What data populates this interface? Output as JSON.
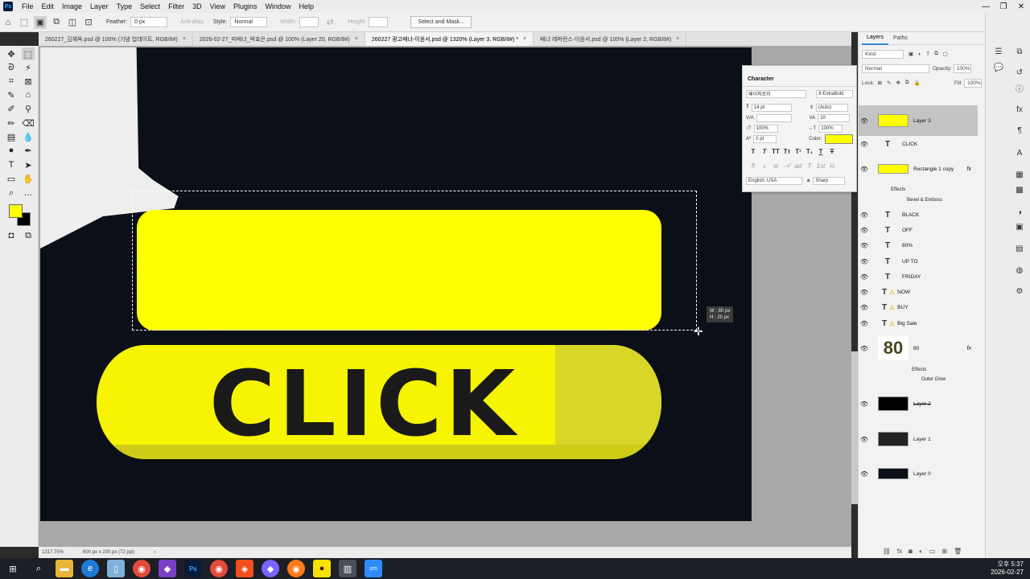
{
  "menubar": {
    "logo": "Ps",
    "items": [
      "File",
      "Edit",
      "Image",
      "Layer",
      "Type",
      "Select",
      "Filter",
      "3D",
      "View",
      "Plugins",
      "Window",
      "Help"
    ],
    "window_controls": [
      "—",
      "❐",
      "✕"
    ]
  },
  "options_bar": {
    "feather_label": "Feather:",
    "feather_value": "0 px",
    "antialias_label": "Anti-alias",
    "style_label": "Style:",
    "style_value": "Normal",
    "width_label": "Width:",
    "height_label": "Height:",
    "select_mask_label": "Select and Mask..."
  },
  "tabs": [
    {
      "label": "260227_김혜옥.psd @ 100% (기념 업데이트, RGB/8#)",
      "active": false
    },
    {
      "label": "2026-02-27_띠배너_박효은.psd @ 100% (Layer 20, RGB/8#)",
      "active": false
    },
    {
      "label": "260227 광고배너-이윤서.psd @ 1320% (Layer 3, RGB/8#) *",
      "active": true
    },
    {
      "label": "배너 레퍼런스-이윤서.psd @ 100% (Layer 2, RGB/8#)",
      "active": false
    }
  ],
  "tab_close": "×",
  "canvas": {
    "button_text": "CLICK",
    "readout_w": "W : 80 px",
    "readout_h": "H : 20 px"
  },
  "status": {
    "zoom": "1317.75%",
    "doc_size": "600 px x 200 px (72 ppi)"
  },
  "character_panel": {
    "title": "Character",
    "font_family": "페이퍼로지",
    "font_style": "8 ExtraBold",
    "size": "14 pt",
    "leading": "(Auto)",
    "kerning": "",
    "tracking": "10",
    "vscale": "100%",
    "hscale": "100%",
    "baseline": "0 pt",
    "color_label": "Color:",
    "language": "English: USA",
    "aa_label": "a",
    "aa_value": "Sharp"
  },
  "layers_panel": {
    "tabs": [
      "Layers",
      "Paths"
    ],
    "filter_kind": "Kind",
    "blend_mode": "Normal",
    "opacity_label": "Opacity:",
    "opacity_value": "100%",
    "lock_label": "Lock:",
    "fill_label": "Fill:",
    "fill_value": "100%",
    "layers": [
      {
        "name": "Layer 3",
        "kind": "pixel-yellow",
        "selected": true
      },
      {
        "name": "CLICK",
        "kind": "text"
      },
      {
        "name": "Rectangle 1 copy",
        "kind": "pixel-yellow",
        "fx": "fx"
      },
      {
        "name": "BLACK",
        "kind": "text"
      },
      {
        "name": "OFF",
        "kind": "text"
      },
      {
        "name": "80%",
        "kind": "text"
      },
      {
        "name": "UP TO",
        "kind": "text"
      },
      {
        "name": "FRIDAY",
        "kind": "text"
      },
      {
        "name": "NOW",
        "kind": "text-warn"
      },
      {
        "name": "BUY",
        "kind": "text-warn"
      },
      {
        "name": "Big Sale",
        "kind": "text-warn"
      },
      {
        "name": "80",
        "kind": "smart",
        "fx": "fx"
      },
      {
        "name": "Layer 2",
        "kind": "pixel-dark"
      },
      {
        "name": "Layer 1",
        "kind": "pixel-dark"
      },
      {
        "name": "Layer 0",
        "kind": "pixel-dark"
      }
    ],
    "effects_label": "Effects",
    "bevel_label": "Bevel & Emboss",
    "outer_glow_label": "Outer Glow",
    "thumb_80_text": "80"
  },
  "taskbar": {
    "apps": [
      "win-icon",
      "search-icon",
      "explorer-icon",
      "edge-icon",
      "files-icon",
      "chrome-icon",
      "vs-icon",
      "photoshop-icon",
      "chrome-icon",
      "figma-icon",
      "droplet-icon",
      "firefox-icon",
      "kakao-icon",
      "store-icon",
      "zoom-icon"
    ],
    "ps_label": "Ps",
    "zm_label": "zm",
    "time": "오후 5:37",
    "date": "2026-02-27"
  },
  "colors": {
    "foreground": "#ffff00",
    "background": "#000000",
    "canvas_bg": "#0b0f17",
    "accent": "#3a84d8"
  }
}
